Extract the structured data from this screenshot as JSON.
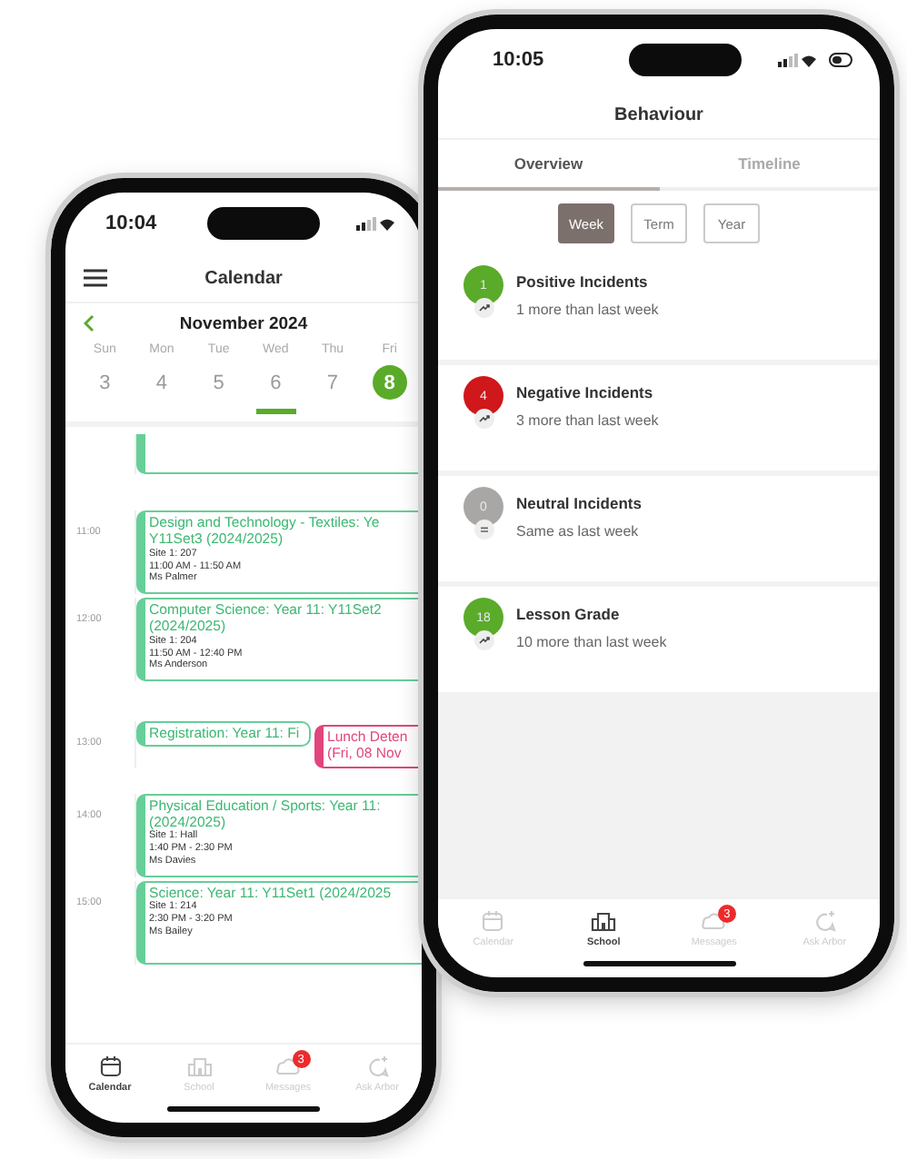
{
  "calendar_phone": {
    "status_time": "10:04",
    "title": "Calendar",
    "month": "November 2024",
    "days": [
      {
        "name": "Sun",
        "date": "3",
        "selected": false
      },
      {
        "name": "Mon",
        "date": "4",
        "selected": false
      },
      {
        "name": "Tue",
        "date": "5",
        "selected": false
      },
      {
        "name": "Wed",
        "date": "6",
        "selected": false
      },
      {
        "name": "Thu",
        "date": "7",
        "selected": false
      },
      {
        "name": "Fri",
        "date": "8",
        "selected": true
      }
    ],
    "timeline": [
      {
        "events": [
          {
            "kind": "lesson"
          }
        ]
      },
      {
        "time": "11:00",
        "events": [
          {
            "kind": "lesson",
            "title_lines": [
              "Design and Technology - Textiles: Ye",
              "Y11Set3 (2024/2025)"
            ],
            "details": [
              "Site 1: 207",
              "11:00 AM - 11:50 AM",
              "Ms Palmer"
            ]
          }
        ]
      },
      {
        "time": "12:00",
        "events": [
          {
            "kind": "lesson",
            "title_lines": [
              "Computer Science: Year 11: Y11Set2",
              "(2024/2025)"
            ],
            "details": [
              "Site 1: 204",
              "11:50 AM - 12:40 PM",
              "Ms Anderson"
            ]
          }
        ]
      },
      {
        "time": "13:00",
        "events": [
          {
            "kind": "lesson",
            "title_lines": [
              "Registration: Year 11: Fi"
            ]
          },
          {
            "kind": "detention",
            "title_lines": [
              "Lunch Deten",
              "(Fri, 08 Nov"
            ]
          }
        ]
      },
      {
        "time": "14:00",
        "events": [
          {
            "kind": "lesson",
            "title_lines": [
              "Physical Education / Sports: Year 11:",
              "(2024/2025)"
            ],
            "details": [
              "Site 1: Hall",
              "1:40 PM - 2:30 PM",
              "Ms Davies"
            ]
          }
        ]
      },
      {
        "time": "15:00",
        "events": [
          {
            "kind": "lesson",
            "title_lines": [
              "Science: Year 11: Y11Set1 (2024/2025"
            ],
            "details": [
              "Site 1: 214",
              "2:30 PM - 3:20 PM",
              "Ms Bailey"
            ]
          }
        ]
      }
    ],
    "tab_bar": [
      {
        "label": "Calendar",
        "kind": "calendar",
        "selected": true
      },
      {
        "label": "School",
        "kind": "school",
        "selected": false
      },
      {
        "label": "Messages",
        "kind": "messages",
        "selected": false,
        "badge": "3"
      },
      {
        "label": "Ask Arbor",
        "kind": "ask",
        "selected": false
      }
    ]
  },
  "behaviour_phone": {
    "status_time": "10:05",
    "title": "Behaviour",
    "tabs": [
      {
        "label": "Overview",
        "selected": true
      },
      {
        "label": "Timeline",
        "selected": false
      }
    ],
    "periods": [
      {
        "label": "Week",
        "selected": true
      },
      {
        "label": "Term",
        "selected": false
      },
      {
        "label": "Year",
        "selected": false
      }
    ],
    "incidents": [
      {
        "count": "1",
        "color": "#5aab2a",
        "title": "Positive Incidents",
        "comparison": "1 more than last week",
        "kind": "up"
      },
      {
        "count": "4",
        "color": "#d0171b",
        "title": "Negative Incidents",
        "comparison": "3 more than last week",
        "kind": "up"
      },
      {
        "count": "0",
        "color": "#a9a7a6",
        "title": "Neutral Incidents",
        "comparison": "Same as last week",
        "kind": "same"
      },
      {
        "count": "18",
        "color": "#5aab2a",
        "title": "Lesson Grade",
        "comparison": "10 more than last week",
        "kind": "up"
      }
    ],
    "tab_bar": [
      {
        "label": "Calendar",
        "kind": "calendar",
        "selected": false
      },
      {
        "label": "School",
        "kind": "school",
        "selected": true
      },
      {
        "label": "Messages",
        "kind": "messages",
        "selected": false,
        "badge": "3"
      },
      {
        "label": "Ask Arbor",
        "kind": "ask",
        "selected": false
      }
    ]
  }
}
